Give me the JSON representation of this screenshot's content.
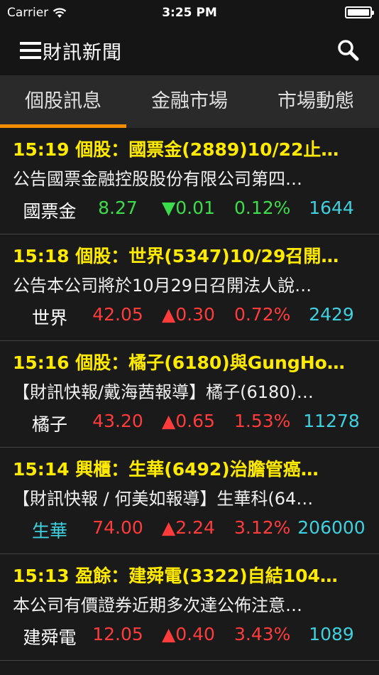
{
  "status": {
    "carrier": "Carrier",
    "time": "3:25 PM"
  },
  "nav": {
    "title": "財訊新聞"
  },
  "tabs": [
    {
      "label": "個股訊息"
    },
    {
      "label": "金融市場"
    },
    {
      "label": "市場動態"
    }
  ],
  "news": [
    {
      "title": "15:19 個股：國票金(2889)10/22止…",
      "summary": "公告國票金融控股股份有限公司第四…",
      "name": "國票金",
      "price": "8.27",
      "change": "▼0.01",
      "pct": "0.12%",
      "volume": "1644",
      "direction": "down"
    },
    {
      "title": "15:18 個股：世界(5347)10/29召開…",
      "summary": "公告本公司將於10月29日召開法人說…",
      "name": "世界",
      "price": "42.05",
      "change": "▲0.30",
      "pct": "0.72%",
      "volume": "2429",
      "direction": "up"
    },
    {
      "title": "15:16 個股：橘子(6180)與GungHo…",
      "summary": "【財訊快報/戴海茜報導】橘子(6180)…",
      "name": "橘子",
      "price": "43.20",
      "change": "▲0.65",
      "pct": "1.53%",
      "volume": "11278",
      "direction": "up"
    },
    {
      "title": "15:14 興櫃：生華(6492)治膽管癌…",
      "summary": "【財訊快報 / 何美如報導】生華科(64…",
      "name": "生華",
      "price": "74.00",
      "change": "▲2.24",
      "pct": "3.12%",
      "volume": "206000",
      "direction": "up"
    },
    {
      "title": "15:13 盈餘：建舜電(3322)自結104…",
      "summary": "本公司有價證券近期多次達公佈注意…",
      "name": "建舜電",
      "price": "12.05",
      "change": "▲0.40",
      "pct": "3.43%",
      "volume": "1089",
      "direction": "up"
    }
  ],
  "colors": {
    "title": "#ffea00",
    "up": "#ff3c3c",
    "down": "#3ddc4a",
    "volume": "#3fd0e0",
    "tab_indicator": "#f28c00"
  }
}
